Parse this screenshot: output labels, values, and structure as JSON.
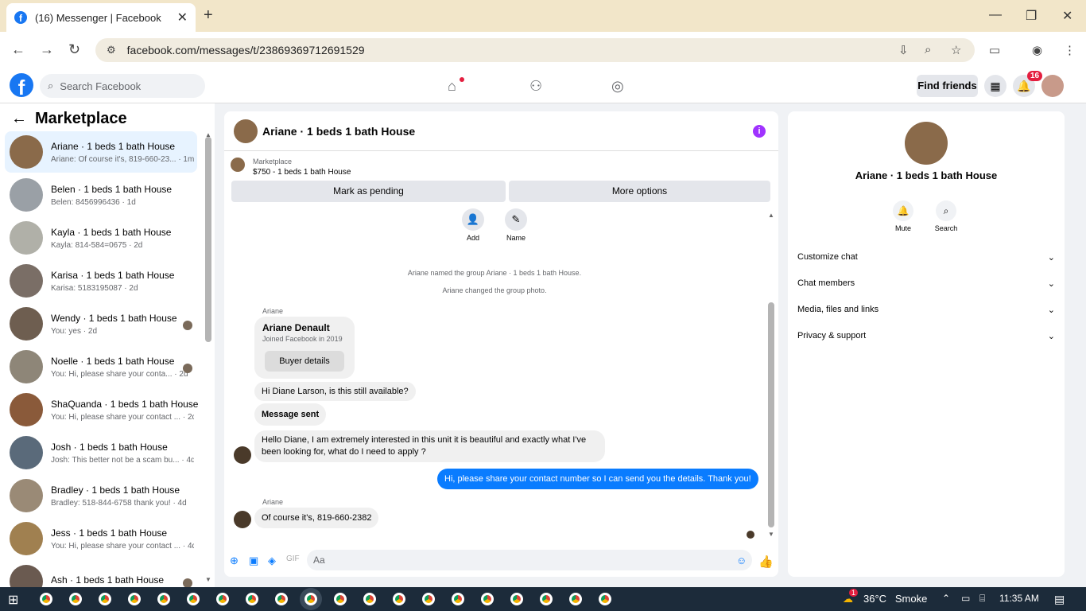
{
  "browser": {
    "tab_title": "(16) Messenger | Facebook",
    "url": "facebook.com/messages/t/23869369712691529"
  },
  "header": {
    "search_placeholder": "Search Facebook",
    "find_friends": "Find friends",
    "notification_count": "16"
  },
  "sidebar": {
    "title": "Marketplace",
    "conversations": [
      {
        "name": "Ariane · 1 beds 1 bath House",
        "preview": "Ariane: Of course it's, 819-660-23... · 1m",
        "selected": true,
        "color": "#8a6a4a"
      },
      {
        "name": "Belen · 1 beds 1 bath House",
        "preview": "Belen: 8456996436 · 1d",
        "color": "#9aa0a6"
      },
      {
        "name": "Kayla · 1 beds 1 bath House",
        "preview": "Kayla: 814-584=0675 · 2d",
        "color": "#b0b0a8"
      },
      {
        "name": "Karisa · 1 beds 1 bath House",
        "preview": "Karisa: 5183195087 · 2d",
        "color": "#7a6e66"
      },
      {
        "name": "Wendy · 1 beds 1 bath House",
        "preview": "You: yes · 2d",
        "color": "#6e5e50"
      },
      {
        "name": "Noelle · 1 beds 1 bath House",
        "preview": "You: Hi, please share your conta... · 2d",
        "color": "#8e8678"
      },
      {
        "name": "ShaQuanda · 1 beds 1 bath House",
        "preview": "You: Hi, please share your contact ... · 2d",
        "color": "#8a5a3a"
      },
      {
        "name": "Josh · 1 beds 1 bath House",
        "preview": "Josh: This better not be a scam bu... · 4d",
        "color": "#5a6a7a"
      },
      {
        "name": "Bradley · 1 beds 1 bath House",
        "preview": "Bradley: 518-844-6758 thank you! · 4d",
        "color": "#9a8a76"
      },
      {
        "name": "Jess · 1 beds 1 bath House",
        "preview": "You: Hi, please share your contact ... · 4d",
        "color": "#a08050"
      },
      {
        "name": "Ash · 1 beds 1 bath House",
        "preview": "",
        "color": "#6a5a50"
      }
    ]
  },
  "chat": {
    "title": "Ariane · 1 beds 1 bath House",
    "marketplace_label": "Marketplace",
    "listing": "$750 - 1 beds 1 bath House",
    "mark_pending": "Mark as pending",
    "more_options": "More options",
    "add_label": "Add",
    "name_label": "Name",
    "system_1": "Ariane named the group Ariane · 1 beds 1 bath House.",
    "system_2": "Ariane changed the group photo.",
    "sender_1": "Ariane",
    "card_name": "Ariane Denault",
    "card_sub": "Joined Facebook in 2019",
    "buyer_details": "Buyer details",
    "msg_1": "Hi Diane Larson, is this still available?",
    "msg_2": "Message sent",
    "msg_3": "Hello Diane, I am extremely interested in this unit it is beautiful and exactly what I've been looking for, what do I need to apply ?",
    "msg_me": "Hi, please share your contact number so I can send you the details. Thank you!",
    "sender_2": "Ariane",
    "msg_4": "Of course it's, 819-660-2382",
    "composer_placeholder": "Aa"
  },
  "details": {
    "name": "Ariane · 1 beds 1 bath House",
    "mute": "Mute",
    "search": "Search",
    "sections": [
      "Customize chat",
      "Chat members",
      "Media, files and links",
      "Privacy & support"
    ]
  },
  "taskbar": {
    "temperature": "36°C",
    "weather": "Smoke",
    "time": "11:35 AM",
    "weather_badge": "1"
  },
  "colors": {
    "accent": "#0a7cff",
    "fb_blue": "#1877f2",
    "badge": "#e41e3f"
  }
}
